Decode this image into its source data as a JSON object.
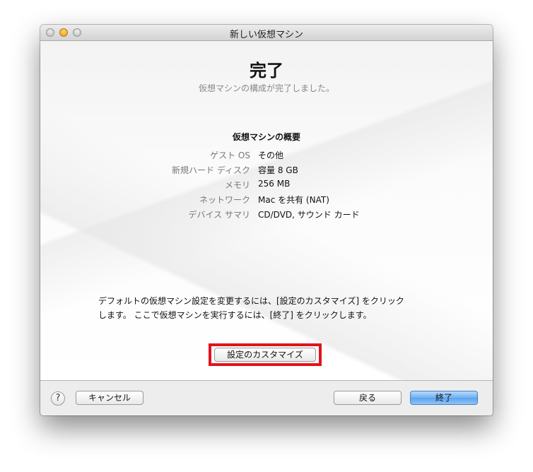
{
  "window": {
    "title": "新しい仮想マシン"
  },
  "header": {
    "title": "完了",
    "subtitle": "仮想マシンの構成が完了しました。"
  },
  "summary": {
    "title": "仮想マシンの概要",
    "rows": [
      {
        "label": "ゲスト OS",
        "value": "その他"
      },
      {
        "label": "新規ハード ディスク",
        "value": "容量 8 GB"
      },
      {
        "label": "メモリ",
        "value": "256 MB"
      },
      {
        "label": "ネットワーク",
        "value": "Mac を共有 (NAT)"
      },
      {
        "label": "デバイス サマリ",
        "value": "CD/DVD, サウンド カード"
      }
    ]
  },
  "info": {
    "line1": "デフォルトの仮想マシン設定を変更するには、[設定のカスタマイズ] をクリック",
    "line2": "します。 ここで仮想マシンを実行するには、[終了] をクリックします。"
  },
  "buttons": {
    "customize": "設定のカスタマイズ",
    "help": "?",
    "cancel": "キャンセル",
    "back": "戻る",
    "finish": "終了"
  },
  "colors": {
    "highlight": "#e0141b",
    "default_button": "#6fb0f1"
  }
}
